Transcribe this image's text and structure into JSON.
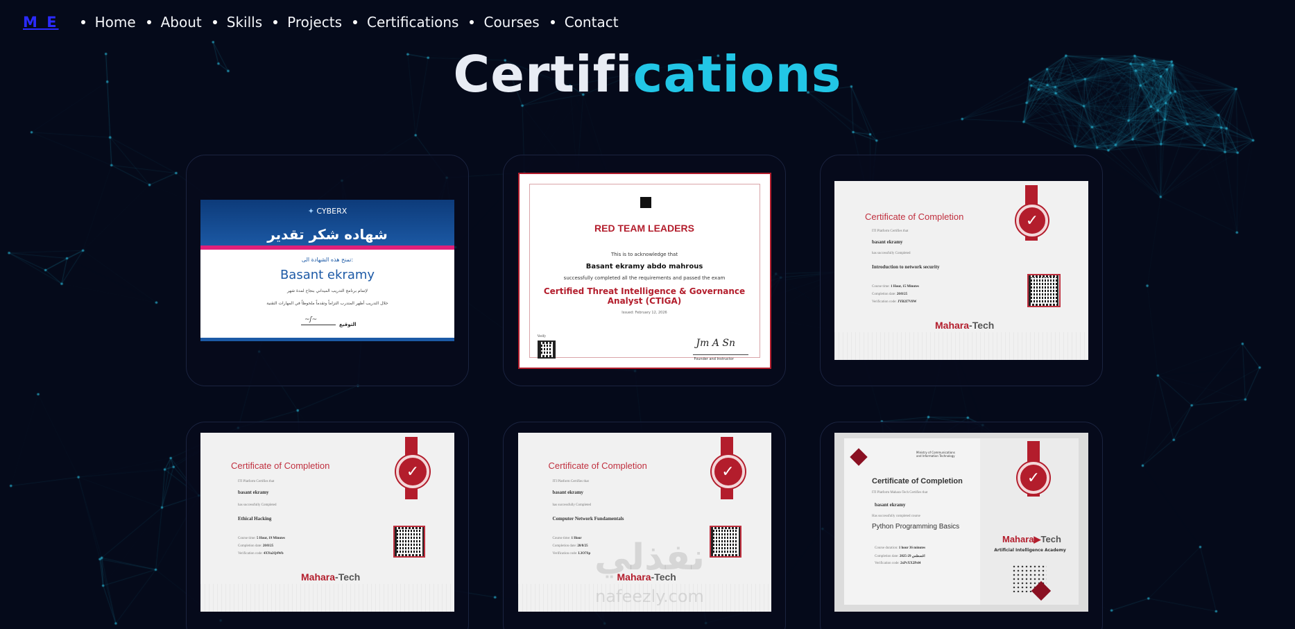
{
  "nav": {
    "logo": "M E",
    "items": [
      "Home",
      "About",
      "Skills",
      "Projects",
      "Certifications",
      "Courses",
      "Contact"
    ]
  },
  "title": {
    "part1": "Certifi",
    "part2": "cations"
  },
  "colors": {
    "accent": "#22c6e6",
    "background": "#050a1a",
    "logo": "#2b2bff",
    "cert_red": "#b31d2c"
  },
  "certs": {
    "cyberx": {
      "brand": "CYBERX",
      "heading": "شهاده شكر تقدير",
      "sub": "تمنح هذه الشهادة الى:",
      "name": "Basant ekramy",
      "line1": "لإتمام برنامج التدريب الميداني بنجاح لمدة شهر",
      "line2": "خلال التدريب أظهر المتدرب التزاماً وتقدماً ملحوظاً في المهارات التقنية",
      "sign_label": "التوقيع"
    },
    "redteam": {
      "title": "RED TEAM LEADERS",
      "ack": "This is to acknowledge that",
      "name": "Basant ekramy abdo mahrous",
      "completed": "successfully completed all the requirements and passed the exam",
      "course": "Certified Threat Intelligence & Governance Analyst (CTIGA)",
      "issued": "Issued: February 12, 2026",
      "verify": "Verify",
      "signer": "Founder and Instructor"
    },
    "network_security": {
      "heading": "Certificate of Completion",
      "platform": "ITI Platform Certifies that",
      "name": "basant ekramy",
      "completed": "has successfully Completed",
      "course": "Introduction to network security",
      "time_label": "Course time:",
      "time": "1 Hour, 15 Minutes",
      "date_label": "Completion date:",
      "date": "20/8/25",
      "code_label": "Verification code:",
      "code": "JYB2I7V8W",
      "logo_a": "Mahara",
      "logo_b": "-Tech"
    },
    "ethical_hacking": {
      "heading": "Certificate of Completion",
      "platform": "ITI Platform Certifies that",
      "name": "basant ekramy",
      "completed": "has successfully Completed",
      "course": "Ethical Hacking",
      "time_label": "Course time:",
      "time": "5 Hour, 19 Minutes",
      "date_label": "Completion date:",
      "date": "20/8/25",
      "code_label": "Verification code:",
      "code": "4XYu2Q4Wb",
      "logo_a": "Mahara",
      "logo_b": "-Tech"
    },
    "network_fundamentals": {
      "heading": "Certificate of Completion",
      "platform": "ITI Platform Certifies that",
      "name": "basant ekramy",
      "completed": "has successfully Completed",
      "course": "Computer Network Fundamentals",
      "time_label": "Course time:",
      "time": "1 Hour",
      "date_label": "Completion date:",
      "date": "20/8/25",
      "code_label": "Verification code:",
      "code": "L3O7Sp",
      "logo_a": "Mahara",
      "logo_b": "-Tech",
      "watermark": "نفذلي",
      "watermark2": "nafeezly.com"
    },
    "python": {
      "heading": "Certificate of Completion",
      "platform": "ITI Platform Mahara-Tech Certifies that",
      "name": "basant ekramy",
      "completed": "Has successfully completed course",
      "course": "Python Programming Basics",
      "time_label": "Course duration:",
      "time": "1 hour 36 minutes",
      "date_label": "Completion date:",
      "date": "2025-29 اغسطس",
      "code_label": "Verification code:",
      "code": "2xPvXX2Pel4",
      "logo_a": "Mahara",
      "logo_b": "Tech",
      "academy": "Artificial Intelligence Academy",
      "ministry": "Ministry of Communications and Information Technology"
    }
  }
}
